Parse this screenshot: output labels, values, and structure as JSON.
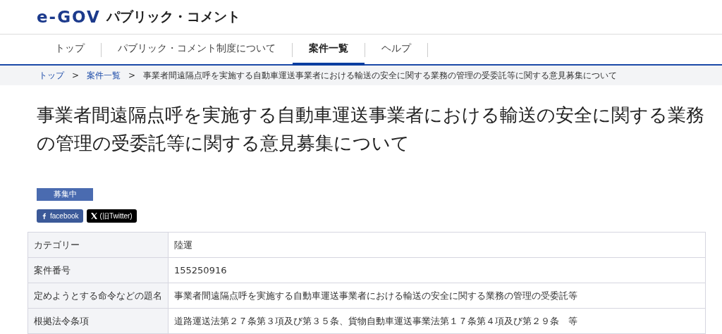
{
  "header": {
    "logo": "e-GOV",
    "site_title": "パブリック・コメント"
  },
  "nav": [
    {
      "label": "トップ",
      "selected": false
    },
    {
      "label": "パブリック・コメント制度について",
      "selected": false
    },
    {
      "label": "案件一覧",
      "selected": true
    },
    {
      "label": "ヘルプ",
      "selected": false
    }
  ],
  "breadcrumb": [
    {
      "label": "トップ",
      "link": true
    },
    {
      "label": "案件一覧",
      "link": true
    },
    {
      "label": "事業者間遠隔点呼を実施する自動車運送事業者における輸送の安全に関する業務の管理の受委託等に関する意見募集について",
      "link": false
    }
  ],
  "breadcrumb_separator": ">",
  "title": "事業者間遠隔点呼を実施する自動車運送事業者における輸送の安全に関する業務の管理の受委託等に関する意見募集について",
  "status_badge": "募集中",
  "share": [
    {
      "kind": "facebook",
      "label": "facebook"
    },
    {
      "kind": "x",
      "label": "(旧Twitter)"
    }
  ],
  "details": [
    {
      "label": "カテゴリー",
      "value": "陸運"
    },
    {
      "label": "案件番号",
      "value": "155250916"
    },
    {
      "label": "定めようとする命令などの題名",
      "value": "事業者間遠隔点呼を実施する自動車運送事業者における輸送の安全に関する業務の管理の受委託等"
    },
    {
      "label": "根拠法令条項",
      "value": "道路運送法第２７条第３項及び第３５条、貨物自動車運送事業法第１７条第４項及び第２９条　等"
    }
  ]
}
